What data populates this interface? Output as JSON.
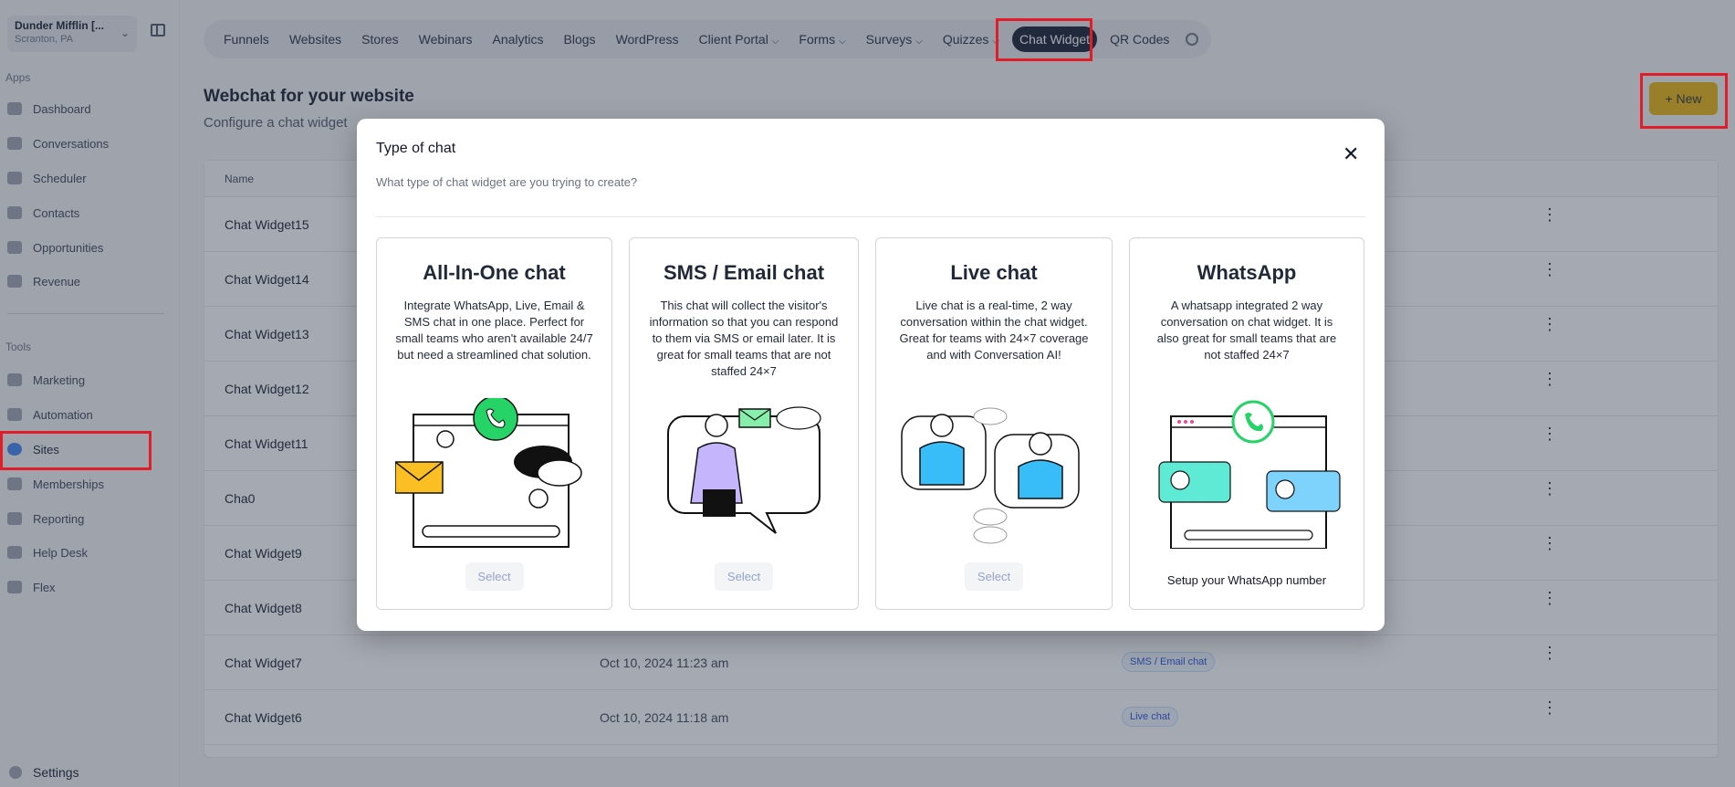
{
  "account": {
    "name": "Dunder Mifflin [...",
    "location": "Scranton, PA"
  },
  "sidebar": {
    "apps_label": "Apps",
    "tools_label": "Tools",
    "apps": [
      {
        "label": "Dashboard"
      },
      {
        "label": "Conversations"
      },
      {
        "label": "Scheduler"
      },
      {
        "label": "Contacts"
      },
      {
        "label": "Opportunities"
      },
      {
        "label": "Revenue"
      }
    ],
    "tools": [
      {
        "label": "Marketing"
      },
      {
        "label": "Automation"
      },
      {
        "label": "Sites"
      },
      {
        "label": "Memberships"
      },
      {
        "label": "Reporting"
      },
      {
        "label": "Help Desk"
      },
      {
        "label": "Flex"
      }
    ],
    "settings_label": "Settings"
  },
  "topnav": {
    "tabs": [
      {
        "label": "Funnels"
      },
      {
        "label": "Websites"
      },
      {
        "label": "Stores"
      },
      {
        "label": "Webinars"
      },
      {
        "label": "Analytics"
      },
      {
        "label": "Blogs"
      },
      {
        "label": "WordPress"
      },
      {
        "label": "Client Portal"
      },
      {
        "label": "Forms"
      },
      {
        "label": "Surveys"
      },
      {
        "label": "Quizzes"
      },
      {
        "label": "Chat Widget"
      },
      {
        "label": "QR Codes"
      }
    ]
  },
  "page": {
    "title": "Webchat for your website",
    "subtitle": "Configure a chat widget",
    "new_button": "+ New"
  },
  "table": {
    "header_name": "Name",
    "rows": [
      {
        "name": "Chat Widget15",
        "date": "",
        "type": ""
      },
      {
        "name": "Chat Widget14",
        "date": "",
        "type": ""
      },
      {
        "name": "Chat Widget13",
        "date": "",
        "type": ""
      },
      {
        "name": "Chat Widget12",
        "date": "",
        "type": ""
      },
      {
        "name": "Chat Widget11",
        "date": "",
        "type": ""
      },
      {
        "name": "Cha0",
        "date": "",
        "type": ""
      },
      {
        "name": "Chat Widget9",
        "date": "",
        "type": ""
      },
      {
        "name": "Chat Widget8",
        "date": "",
        "type": ""
      },
      {
        "name": "Chat Widget7",
        "date": "Oct 10, 2024 11:23 am",
        "type": "SMS / Email chat"
      },
      {
        "name": "Chat Widget6",
        "date": "Oct 10, 2024 11:18 am",
        "type": "Live chat"
      }
    ]
  },
  "modal": {
    "title": "Type of chat",
    "subtitle": "What type of chat widget are you trying to create?",
    "cards": [
      {
        "title": "All-In-One chat",
        "description": "Integrate WhatsApp, Live, Email & SMS chat in one place. Perfect for small teams who aren't available 24/7 but need a streamlined chat solution.",
        "action": "Select"
      },
      {
        "title": "SMS / Email chat",
        "description": "This chat will collect the visitor's information so that you can respond to them via SMS or email later. It is great for small teams that are not staffed 24×7",
        "action": "Select"
      },
      {
        "title": "Live chat",
        "description": "Live chat is a real-time, 2 way conversation within the chat widget. Great for teams with 24×7 coverage and with Conversation AI!",
        "action": "Select"
      },
      {
        "title": "WhatsApp",
        "description": "A whatsapp integrated 2 way conversation on chat widget. It is also great for small teams that are not staffed 24×7",
        "action": "Setup your WhatsApp number"
      }
    ]
  },
  "colors": {
    "accent": "#eab308",
    "highlight": "#e11d2a",
    "whatsapp": "#25d366",
    "livechat": "#38bdf8"
  }
}
